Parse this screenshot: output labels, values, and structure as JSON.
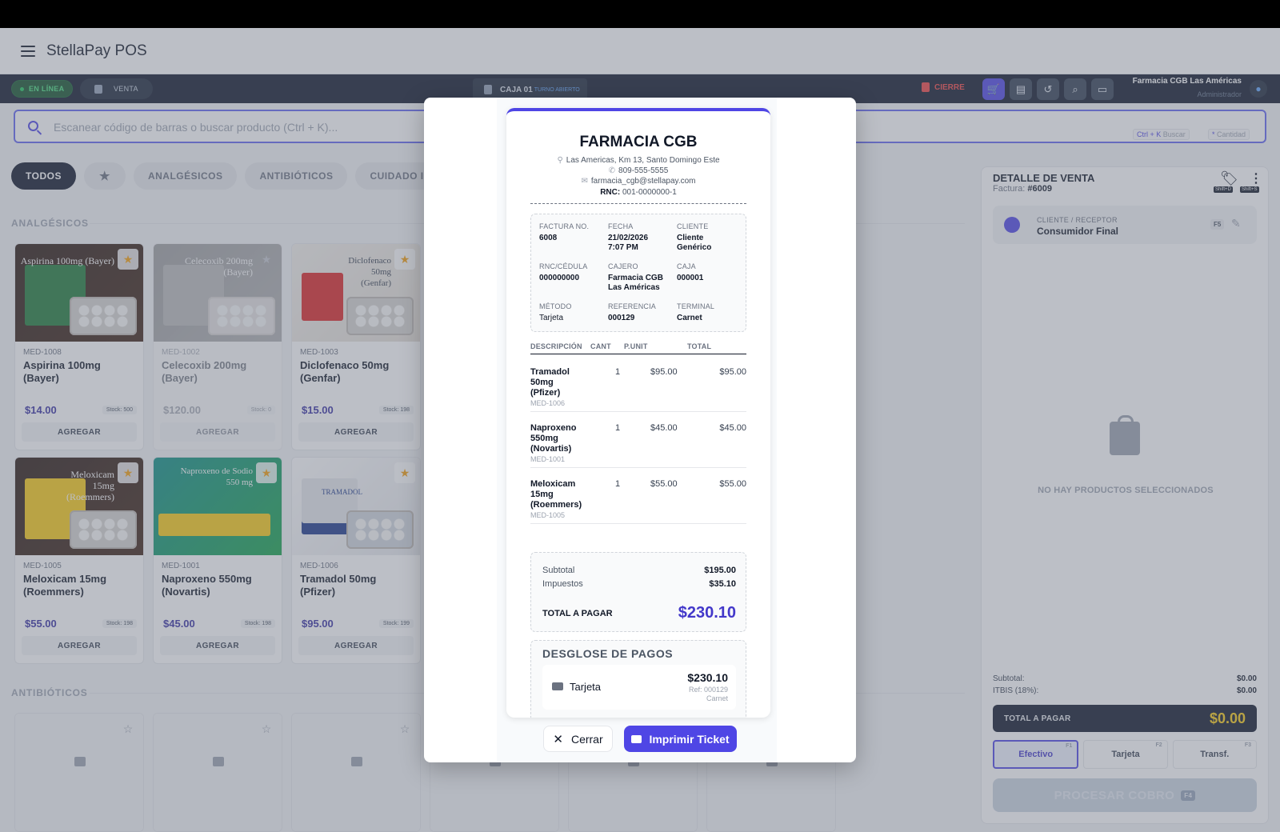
{
  "app": {
    "title": "StellaPay POS"
  },
  "status": {
    "online": "EN LÍNEA",
    "mode": "VENTA",
    "register": "CAJA 01",
    "register_sub": "TURNO ABIERTO",
    "close_shift": "CIERRE",
    "user_name": "Farmacia CGB Las Américas",
    "user_role": "Administrador"
  },
  "search": {
    "placeholder": "Escanear código de barras o buscar producto (Ctrl + K)...",
    "hint1_key": "Ctrl + K",
    "hint1_label": "Buscar",
    "hint2_key": "*",
    "hint2_label": "Cantidad"
  },
  "categories": [
    "TODOS",
    "★",
    "ANALGÉSICOS",
    "ANTIBIÓTICOS",
    "CUIDADO INFA"
  ],
  "sections": {
    "analgesics": "ANALGÉSICOS",
    "antibiotics": "ANTIBIÓTICOS"
  },
  "products": [
    {
      "sku": "MED-1008",
      "name": "Aspirina 100mg (Bayer)",
      "price": "$14.00",
      "stock": "Stock: 500",
      "add": "AGREGAR",
      "img_text": "Aspirina 100mg (Bayer)"
    },
    {
      "sku": "MED-1002",
      "name": "Celecoxib 200mg (Bayer)",
      "price": "$120.00",
      "stock": "Stock: 0",
      "add": "AGREGAR",
      "img_text": "Celecoxib 200mg (Bayer)"
    },
    {
      "sku": "MED-1003",
      "name": "Diclofenaco 50mg (Genfar)",
      "price": "$15.00",
      "stock": "Stock: 198",
      "add": "AGREGAR",
      "img_text": "Diclofenaco 50mg (Genfar)"
    },
    {
      "sku": "MED-1005",
      "name": "Meloxicam 15mg (Roemmers)",
      "price": "$55.00",
      "stock": "Stock: 198",
      "add": "AGREGAR",
      "img_text": "Meloxicam 15mg (Roemmers)"
    },
    {
      "sku": "MED-1001",
      "name": "Naproxeno 550mg (Novartis)",
      "price": "$45.00",
      "stock": "Stock: 198",
      "add": "AGREGAR",
      "img_text": "Naproxeno de Sodio 550 mg"
    },
    {
      "sku": "MED-1006",
      "name": "Tramadol 50mg (Pfizer)",
      "price": "$95.00",
      "stock": "Stock: 199",
      "add": "AGREGAR",
      "img_text": "TRAMADOL"
    }
  ],
  "sale_detail": {
    "title": "DETALLE DE VENTA",
    "invoice_label": "Factura:",
    "invoice_no": "#6009",
    "tag_key": "Shift+D",
    "more_key": "Shift+S",
    "client_label": "CLIENTE / RECEPTOR",
    "client_name": "Consumidor Final",
    "client_key": "F5",
    "empty_text": "NO HAY PRODUCTOS SELECCIONADOS",
    "subtotal_label": "Subtotal:",
    "subtotal": "$0.00",
    "tax_label": "ITBIS (18%):",
    "tax": "$0.00",
    "total_label": "TOTAL A PAGAR",
    "total": "$0.00",
    "pay_methods": [
      {
        "label": "Efectivo",
        "key": "F1"
      },
      {
        "label": "Tarjeta",
        "key": "F2"
      },
      {
        "label": "Transf.",
        "key": "F3"
      }
    ],
    "process_label": "PROCESAR COBRO",
    "process_key": "F4"
  },
  "receipt": {
    "business": "FARMACIA CGB",
    "address": "Las Americas, Km 13, Santo Domingo Este",
    "phone": "809-555-5555",
    "email": "farmacia_cgb@stellapay.com",
    "rnc_label": "RNC:",
    "rnc": "001-0000000-1",
    "info": {
      "invoice_label": "FACTURA NO.",
      "invoice": "6008",
      "date_label": "FECHA",
      "date": "21/02/2026",
      "time": "7:07 PM",
      "client_label": "CLIENTE",
      "client": "Cliente Genérico",
      "rnc_label": "RNC/CÉDULA",
      "rnc": "000000000",
      "cashier_label": "CAJERO",
      "cashier": "Farmacia CGB Las Américas",
      "register_label": "CAJA",
      "register": "000001",
      "method_label": "MÉTODO",
      "method": "Tarjeta",
      "ref_label": "REFERENCIA",
      "ref": "000129",
      "terminal_label": "TERMINAL",
      "terminal": "Carnet"
    },
    "columns": [
      "DESCRIPCIÓN",
      "CANT",
      "P.UNIT",
      "TOTAL"
    ],
    "items": [
      {
        "name": "Tramadol 50mg (Pfizer)",
        "sku": "MED-1006",
        "qty": "1",
        "unit": "$95.00",
        "total": "$95.00"
      },
      {
        "name": "Naproxeno 550mg (Novartis)",
        "sku": "MED-1001",
        "qty": "1",
        "unit": "$45.00",
        "total": "$45.00"
      },
      {
        "name": "Meloxicam 15mg (Roemmers)",
        "sku": "MED-1005",
        "qty": "1",
        "unit": "$55.00",
        "total": "$55.00"
      }
    ],
    "subtotal_label": "Subtotal",
    "subtotal": "$195.00",
    "tax_label": "Impuestos",
    "tax": "$35.10",
    "total_label": "TOTAL A PAGAR",
    "total": "$230.10",
    "payments_title": "DESGLOSE DE PAGOS",
    "payment": {
      "method": "Tarjeta",
      "amount": "$230.10",
      "ref": "Ref: 000129",
      "terminal": "Carnet"
    }
  },
  "modal_actions": {
    "close": "Cerrar",
    "print": "Imprimir Ticket"
  },
  "colors": {
    "accent": "#4f46e5",
    "dark": "#0f172a",
    "total_yellow": "#facc15",
    "star": "#f59e0b"
  }
}
